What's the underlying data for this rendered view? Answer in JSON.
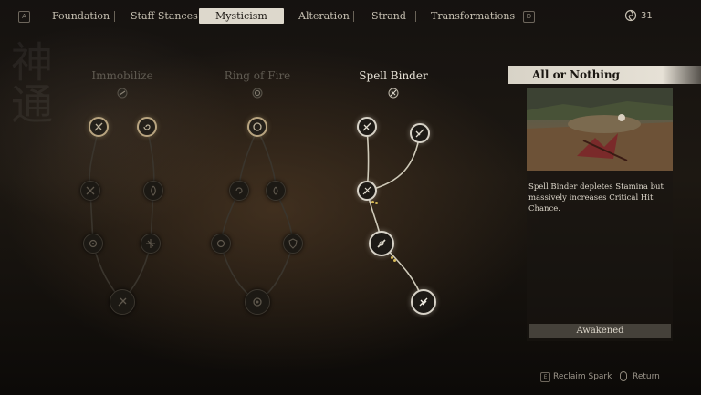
{
  "nav": {
    "left_key": "A",
    "right_key": "D",
    "tabs": [
      {
        "label": "Foundation"
      },
      {
        "label": "Staff Stances"
      },
      {
        "label": "Mysticism",
        "active": true
      },
      {
        "label": "Alteration"
      },
      {
        "label": "Strand"
      },
      {
        "label": "Transformations"
      }
    ],
    "spark_count": "31"
  },
  "trees": [
    {
      "title": "Immobilize",
      "state": "locked"
    },
    {
      "title": "Ring of Fire",
      "state": "locked"
    },
    {
      "title": "Spell Binder",
      "state": "unlocked"
    }
  ],
  "selected_skill": {
    "title": "All or Nothing",
    "description": "Spell Binder depletes Stamina but massively increases Critical Hit Chance.",
    "status": "Awakened"
  },
  "footer": {
    "reclaim_key": "E",
    "reclaim_label": "Reclaim Spark",
    "return_label": "Return"
  },
  "colors": {
    "active_tab_bg": "#ddd8cc",
    "gold_ring": "#b8a480",
    "lit_ring": "#d7d2c7",
    "point_dots": "#d6b957"
  }
}
